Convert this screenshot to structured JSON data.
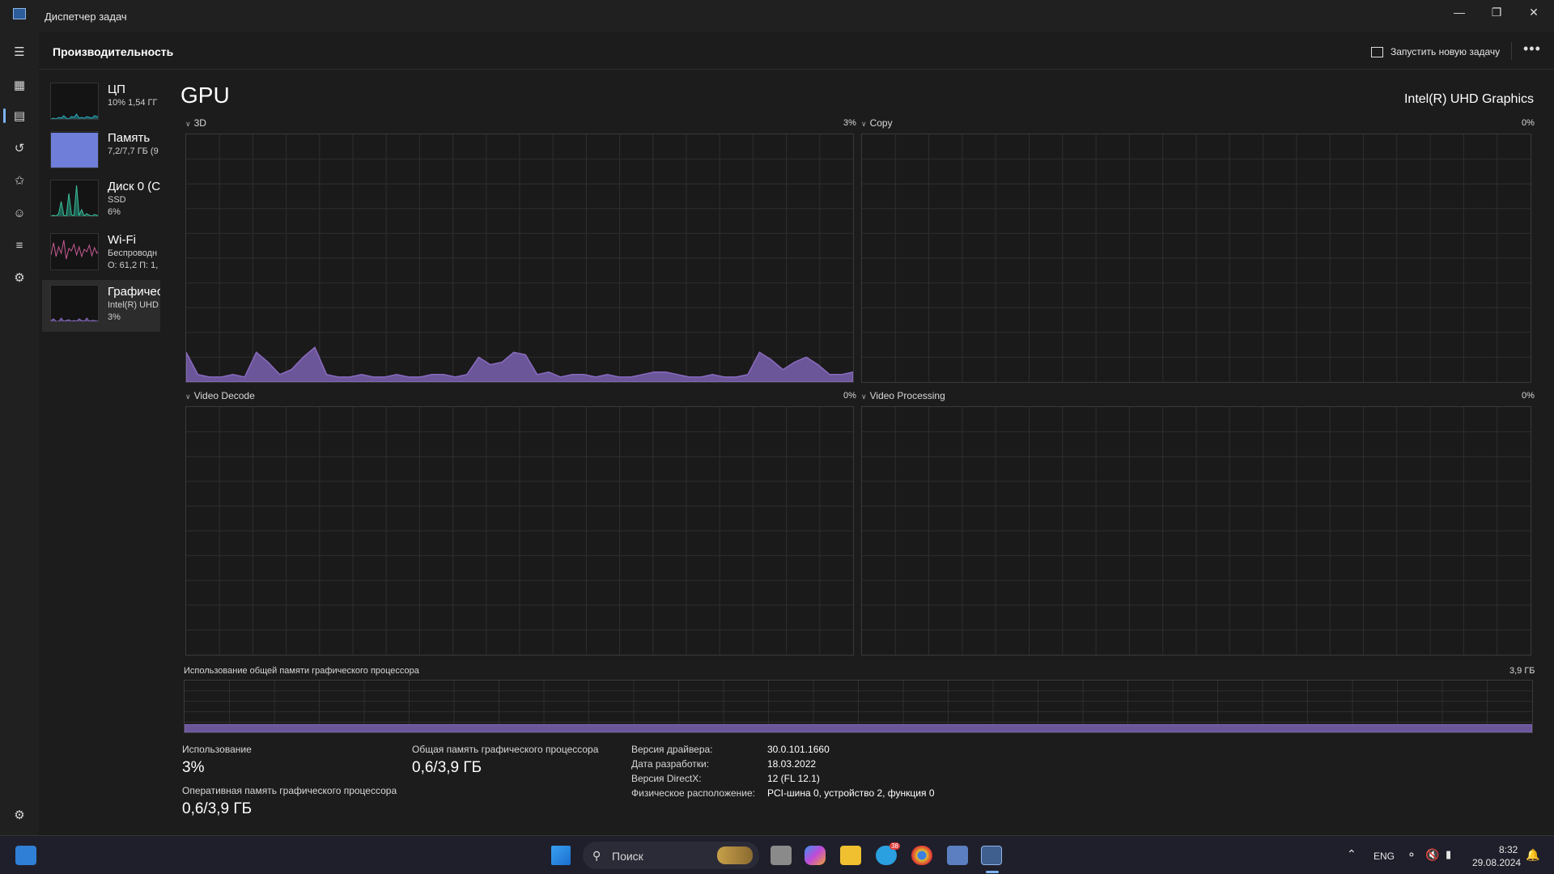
{
  "window": {
    "title": "Диспетчер задач"
  },
  "header": {
    "page_title": "Производительность",
    "run_task_label": "Запустить новую задачу"
  },
  "resources": [
    {
      "name": "ЦП",
      "line1": "10%  1,54 ГГ",
      "line2": ""
    },
    {
      "name": "Память",
      "line1": "7,2/7,7 ГБ (9",
      "line2": ""
    },
    {
      "name": "Диск 0 (C",
      "line1": "SSD",
      "line2": "6%"
    },
    {
      "name": "Wi-Fi",
      "line1": "Беспроводн",
      "line2": "О: 61,2 П: 1,"
    },
    {
      "name": "Графичес",
      "line1": "Intel(R) UHD",
      "line2": "3%"
    }
  ],
  "gpu": {
    "title": "GPU",
    "model": "Intel(R) UHD Graphics",
    "engines": [
      {
        "label": "3D",
        "percent": "3%"
      },
      {
        "label": "Copy",
        "percent": "0%"
      },
      {
        "label": "Video Decode",
        "percent": "0%"
      },
      {
        "label": "Video Processing",
        "percent": "0%"
      }
    ],
    "shared_memory": {
      "label": "Использование общей памяти графического процессора",
      "max": "3,9 ГБ",
      "fill_fraction": 0.15
    },
    "stats": {
      "usage_label": "Использование",
      "usage_value": "3%",
      "shared_label": "Общая память графического процессора",
      "shared_value": "0,6/3,9 ГБ",
      "dedicated_label": "Оперативная память графического процессора",
      "dedicated_value": "0,6/3,9 ГБ"
    },
    "info": [
      {
        "key": "Версия драйвера:",
        "value": "30.0.101.1660"
      },
      {
        "key": "Дата разработки:",
        "value": "18.03.2022"
      },
      {
        "key": "Версия DirectX:",
        "value": "12 (FL 12.1)"
      },
      {
        "key": "Физическое расположение:",
        "value": "PCI-шина 0, устройство 2, функция 0"
      }
    ]
  },
  "usage_series_3d": [
    12,
    3,
    2,
    2,
    3,
    2,
    12,
    8,
    3,
    5,
    10,
    14,
    3,
    2,
    2,
    3,
    2,
    2,
    3,
    2,
    2,
    3,
    3,
    2,
    3,
    10,
    7,
    8,
    12,
    11,
    3,
    4,
    2,
    3,
    3,
    2,
    3,
    2,
    2,
    3,
    4,
    4,
    3,
    2,
    2,
    3,
    2,
    2,
    3,
    12,
    9,
    5,
    8,
    10,
    7,
    3,
    3,
    4
  ],
  "taskbar": {
    "search_placeholder": "Поиск",
    "language": "ENG",
    "time": "8:32",
    "date": "29.08.2024",
    "telegram_badge": "38"
  },
  "colors": {
    "gpu_accent": "#8a6bbf",
    "gpu_fill": "#6b5699",
    "memory_thumb": "#6f7ed8",
    "cpu_accent": "#2aa7b8",
    "wifi_accent": "#c65b93"
  }
}
